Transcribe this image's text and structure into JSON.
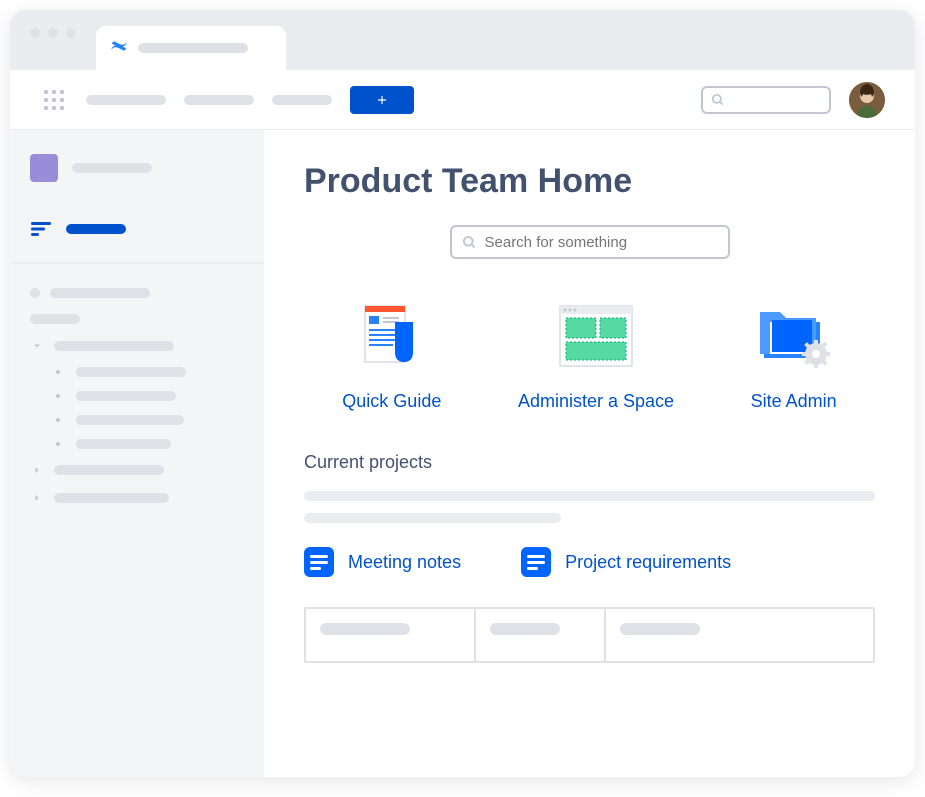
{
  "page": {
    "title": "Product Team Home",
    "search_placeholder": "Search for something"
  },
  "cards": [
    {
      "label": "Quick Guide"
    },
    {
      "label": "Administer a Space"
    },
    {
      "label": "Site Admin"
    }
  ],
  "sections": {
    "current_projects": "Current projects"
  },
  "links": [
    {
      "label": "Meeting notes"
    },
    {
      "label": "Project requirements"
    }
  ],
  "create_label": "+"
}
